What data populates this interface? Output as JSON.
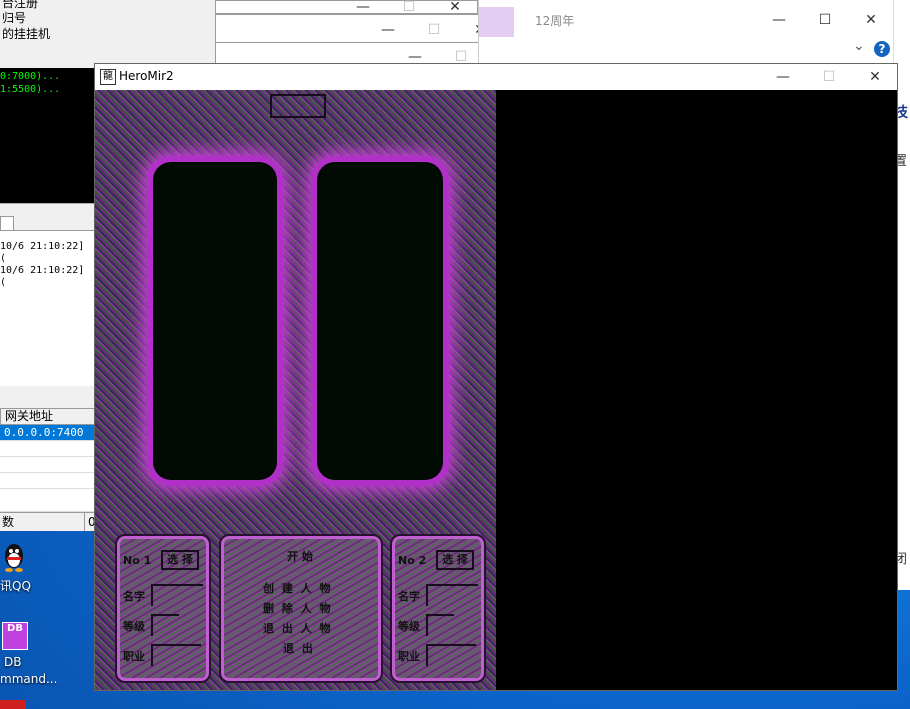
{
  "left_app": {
    "lines": [
      "台注册",
      "归号",
      "的挂挂机"
    ],
    "console_lines": [
      "0:7000)...",
      "1:5500)..."
    ],
    "log_lines": [
      "10/6 21:10:22] (",
      "10/6 21:10:22] ("
    ],
    "grid_header": "网关地址",
    "grid_rows": [
      "0.0.0.0:7400",
      "",
      "",
      "",
      "",
      ""
    ],
    "status_left": "数",
    "status_right": "0"
  },
  "background_windows": [
    {
      "min": "—",
      "max": "☐",
      "close": "✕"
    },
    {
      "min": "—",
      "max": "☐",
      "close": "✕"
    },
    {
      "min": "—",
      "max": "☐",
      "close": "✕"
    }
  ],
  "right_window": {
    "title": "12周年",
    "min": "—",
    "max": "☐",
    "close": "✕",
    "chevron": "⌄",
    "help": "?",
    "side_texts": [
      "技",
      "置",
      "闭"
    ]
  },
  "main_window": {
    "title": "HeroMir2",
    "app_icon_text": "龍",
    "min": "—",
    "max": "☐",
    "close": "✕"
  },
  "game": {
    "left_panel": {
      "slot": "No 1",
      "select": "选 择",
      "fields": [
        "名字",
        "等级",
        "职业"
      ]
    },
    "center_panel": {
      "title": "开 始",
      "rows": [
        "创 建 人 物",
        "删 除 人 物",
        "退 出 人 物",
        "退 出"
      ]
    },
    "right_panel": {
      "slot": "No 2",
      "select": "选 择",
      "fields": [
        "名字",
        "等级",
        "职业"
      ]
    }
  },
  "desktop_icons": [
    {
      "label": "讯QQ",
      "icon": "qq-penguin-icon"
    },
    {
      "label": "DB",
      "label2": "mmand...",
      "icon": "db-command-icon",
      "badge": "DB"
    }
  ]
}
